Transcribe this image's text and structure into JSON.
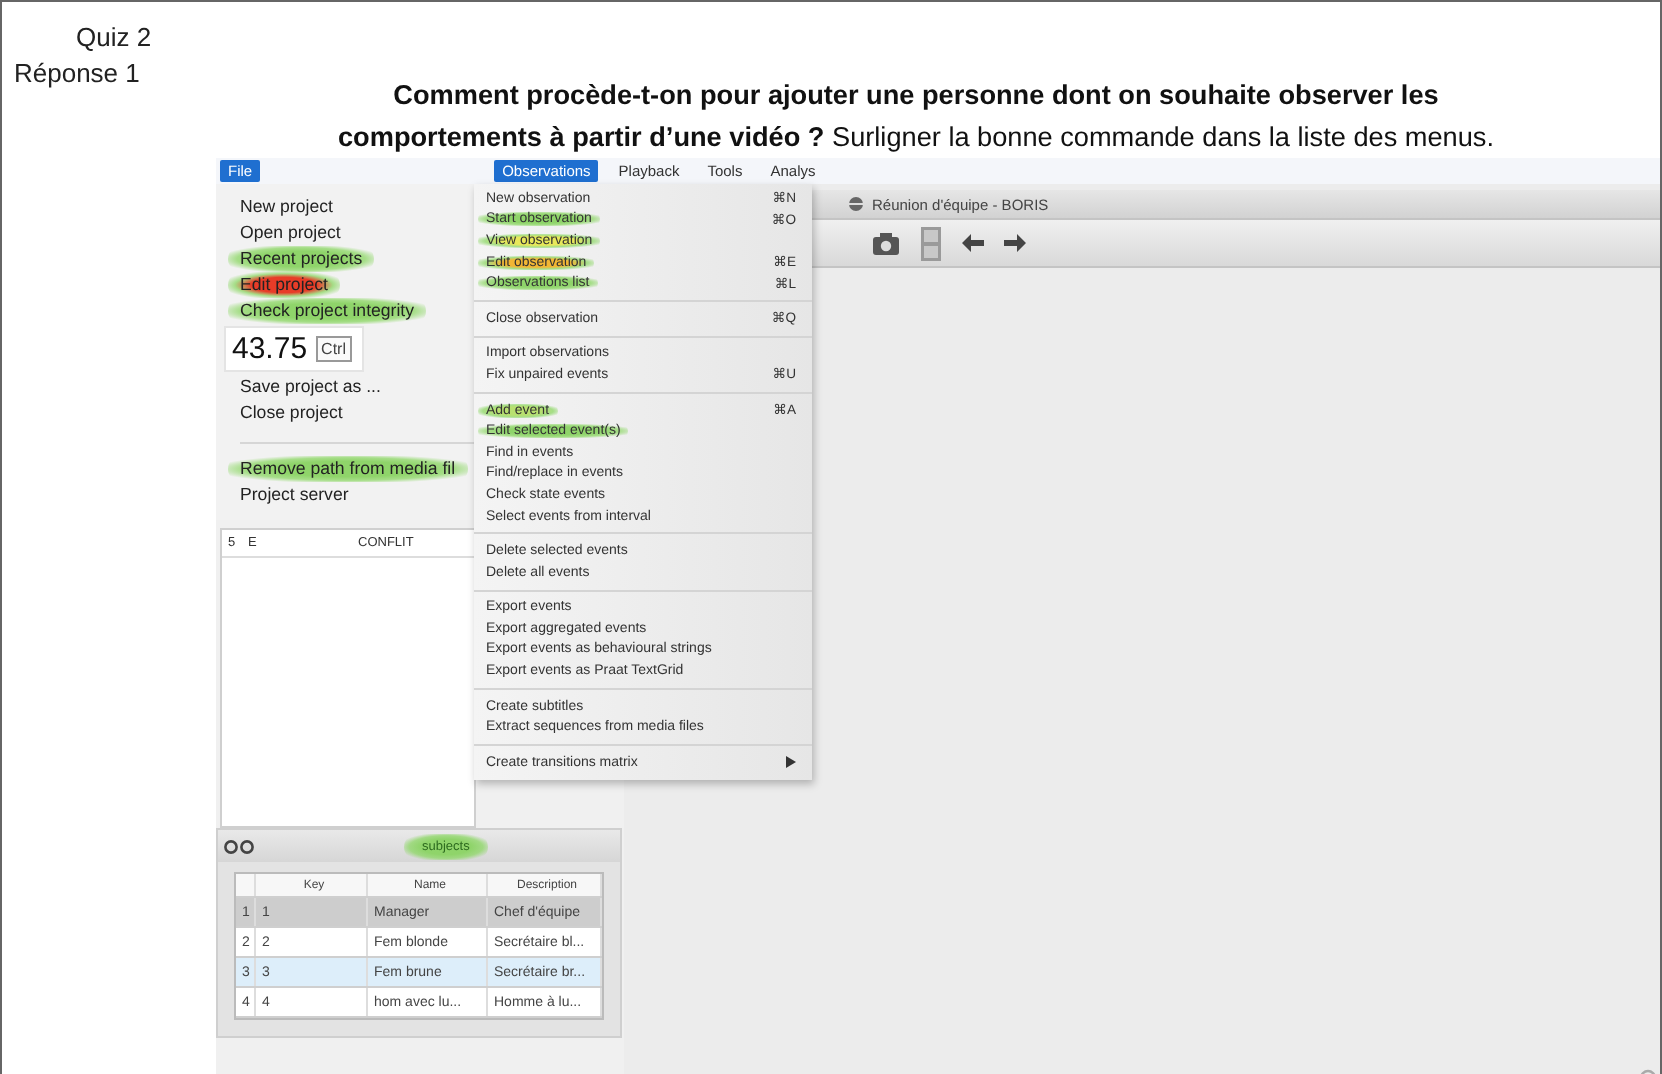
{
  "slide": {
    "quiz_label": "Quiz 2",
    "answer_label": "Réponse 1",
    "question": "**Comment procède-t-on pour ajouter une personne dont on souhaite observer les\ncomportements à partir d’une vidéo ?** Surligner la bonne commande dans la liste des menus."
  },
  "menubar": [
    {
      "label": "File",
      "selected": true
    },
    {
      "label": "Observations",
      "selected": true
    },
    {
      "label": "Playback",
      "selected": false
    },
    {
      "label": "Tools",
      "selected": false
    },
    {
      "label": "Analys",
      "selected": false
    }
  ],
  "file_menu": {
    "groups": [
      [
        {
          "label": "New project"
        },
        {
          "label": "Open project"
        },
        {
          "label": "Recent projects",
          "color": "#8fd46a"
        },
        {
          "label": "Edit project",
          "color": "#e83c28"
        },
        {
          "label": "Check project integrity",
          "color": "#8fd46a"
        },
        {
          "label": "Save project as ..."
        },
        {
          "label": "Close project"
        }
      ],
      [
        {
          "label": "Remove path from media fil",
          "color": "#8fd46a"
        },
        {
          "label": "Project server"
        }
      ]
    ]
  },
  "tooltip": {
    "value": "43.75",
    "key": "Ctrl"
  },
  "left_table": {
    "cells": [
      "5",
      "E",
      "CONFLIT"
    ]
  },
  "observations_menu": {
    "groups": [
      [
        {
          "label": "New observation",
          "shortcut": "⌘N"
        },
        {
          "label": "Start observation",
          "shortcut": "⌘O",
          "color": "#8fd46a"
        },
        {
          "label": "View observation",
          "color": "#e8e85a"
        },
        {
          "label": "Edit observation",
          "shortcut": "⌘E",
          "color": "#f2b634"
        },
        {
          "label": "Observations list",
          "shortcut": "⌘L",
          "color": "#8fd46a"
        }
      ],
      [
        {
          "label": "Close observation",
          "shortcut": "⌘Q"
        }
      ],
      [
        {
          "label": "Import observations"
        },
        {
          "label": "Fix unpaired events",
          "shortcut": "⌘U"
        }
      ],
      [
        {
          "label": "Add event",
          "shortcut": "⌘A",
          "color": "#b8e070"
        },
        {
          "label": "Edit selected event(s)",
          "color": "#8fd46a"
        },
        {
          "label": "Find in events"
        },
        {
          "label": "Find/replace in events"
        },
        {
          "label": "Check state events"
        },
        {
          "label": "Select events from interval"
        }
      ],
      [
        {
          "label": "Delete selected events"
        },
        {
          "label": "Delete all events"
        }
      ],
      [
        {
          "label": "Export events"
        },
        {
          "label": "Export aggregated events"
        },
        {
          "label": "Export events as behavioural strings"
        },
        {
          "label": "Export events as Praat TextGrid"
        }
      ],
      [
        {
          "label": "Create subtitles"
        },
        {
          "label": "Extract sequences from media files"
        }
      ],
      [
        {
          "label": "Create transitions matrix",
          "kind": "submenu"
        }
      ]
    ]
  },
  "window": {
    "title": "Réunion d'équipe - BORIS"
  },
  "subjects": {
    "title": "subjects",
    "color": "#8fd46a",
    "columns": [
      "Key",
      "Name",
      "Description"
    ],
    "rows": [
      {
        "index": "1",
        "cells": [
          "1",
          "Manager",
          "Chef d'équipe"
        ],
        "selected": true
      },
      {
        "index": "2",
        "cells": [
          "2",
          "Fem blonde",
          "Secrétaire bl..."
        ],
        "selected": false
      },
      {
        "index": "3",
        "cells": [
          "3",
          "Fem brune",
          "Secrétaire br..."
        ],
        "selected": false
      },
      {
        "index": "4",
        "cells": [
          "4",
          "hom avec lu...",
          "Homme à lu..."
        ],
        "selected": false
      }
    ]
  }
}
